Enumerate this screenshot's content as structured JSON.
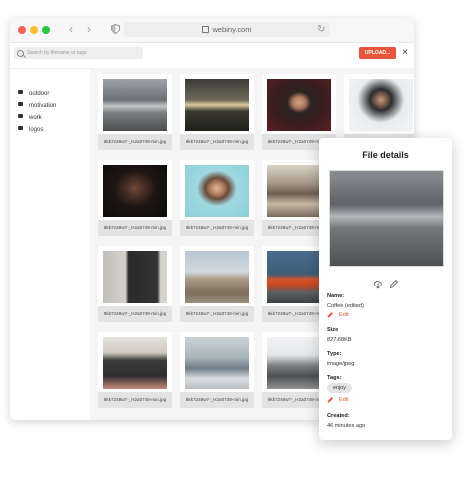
{
  "browser": {
    "url": "webiny.com",
    "nav_back_icon": "chevron-left-icon",
    "nav_forward_icon": "chevron-right-icon",
    "reload_icon": "reload-icon"
  },
  "header": {
    "search_placeholder": "Search by filename or tags",
    "upload_label": "UPLOAD...",
    "close_icon": "close-icon"
  },
  "sidebar": {
    "items": [
      {
        "label": "outdoor"
      },
      {
        "label": "motivation"
      },
      {
        "label": "work"
      },
      {
        "label": "logos"
      }
    ]
  },
  "files": [
    {
      "name": "8kk7248w7-_H2a0749-min.jpg",
      "scene": "stormy-landscape"
    },
    {
      "name": "8kk7248w7-_H2a0749-min.jpg",
      "scene": "sunset-field"
    },
    {
      "name": "8kk7248w7-_H2a0749-min.jpg",
      "scene": "portrait-man-red"
    },
    {
      "name": "8kk7248w7-_H2a0749-min.jpg",
      "scene": "man-sitting"
    },
    {
      "name": "8kk7248w7-_H2a0749-min.jpg",
      "scene": "portrait-man-dark"
    },
    {
      "name": "8kk7248w7-_H2a0749-min.jpg",
      "scene": "woman-smiling"
    },
    {
      "name": "8kk7248w7-_H2a0749-min.jpg",
      "scene": "cafe-interior"
    },
    {
      "name": "8kk7248w7-_H2a0749-min.jpg",
      "scene": "letterboard"
    },
    {
      "name": "8kk7248w7-_H2a0749-min.jpg",
      "scene": "church"
    },
    {
      "name": "8kk7248w7-_H2a0749-min.jpg",
      "scene": "orange-bicycle"
    },
    {
      "name": "8kk7248w7-_H2a0749-min.jpg",
      "scene": "motivation-sign"
    },
    {
      "name": "8kk7248w7-_H2a0749-min.jpg",
      "scene": "street-sign"
    },
    {
      "name": "8kk7248w7-_H2a0749-min.jpg",
      "scene": "people-on-rocks"
    }
  ],
  "details": {
    "title": "File details",
    "name_label": "Name:",
    "name_value": "Coffee (edited)",
    "edit_label": "Edit",
    "size_label": "Size",
    "size_value": "827.68KB",
    "type_label": "Type:",
    "type_value": "image/jpeg",
    "tags_label": "Tags:",
    "tags": [
      "enjoy"
    ],
    "tags_edit_label": "Edit",
    "created_label": "Created:",
    "created_value": "46 minutes ago",
    "download_icon": "download-icon",
    "edit_icon": "pencil-icon"
  },
  "colors": {
    "accent": "#e8553a",
    "traffic_red": "#ff5f57",
    "traffic_yellow": "#febc2e",
    "traffic_green": "#28c840"
  }
}
